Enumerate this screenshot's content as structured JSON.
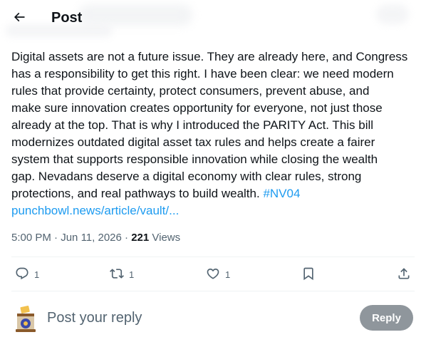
{
  "header": {
    "title": "Post",
    "back_icon": "arrow-left-icon"
  },
  "post": {
    "lines": [
      "Digital assets are not a future issue. They are already here, and Congress",
      "has a responsibility to get this right. I have been clear: we need modern",
      "rules that provide certainty, protect consumers, prevent abuse, and",
      "make sure innovation creates opportunity for everyone, not just those",
      "already at the top. That is why I introduced the PARITY Act. This bill",
      "modernizes outdated digital asset tax rules and helps create a fairer",
      "system that supports responsible innovation while closing the wealth",
      "gap. Nevadans deserve a digital economy with clear rules, strong"
    ],
    "last_line_text": "protections, and real pathways to build wealth. ",
    "hashtag": "#NV04",
    "link_text": "punchbowl.news/article/vault/..."
  },
  "meta": {
    "time": "5:00 PM",
    "separator": " · ",
    "date": "Jun 11, 2026",
    "views_count": "221",
    "views_label": " Views"
  },
  "actions": {
    "reply_count": "1",
    "repost_count": "1",
    "like_count": "1",
    "icons": [
      "reply-icon",
      "repost-icon",
      "like-icon",
      "bookmark-icon",
      "share-icon"
    ]
  },
  "composer": {
    "placeholder": "Post your reply",
    "button_label": "Reply"
  },
  "colors": {
    "text": "#0f1419",
    "secondary": "#536471",
    "link": "#1d9bf0",
    "reply_button": "#8f969c",
    "divider": "#eff3f4"
  }
}
